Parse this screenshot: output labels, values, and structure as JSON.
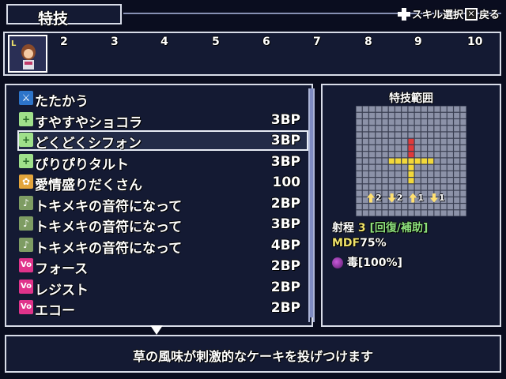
{
  "header": {
    "title": "特技",
    "hint_select": "スキル選択",
    "hint_back": "戻る"
  },
  "party": {
    "slots": [
      "2",
      "3",
      "4",
      "5",
      "6",
      "7",
      "8",
      "9",
      "10"
    ]
  },
  "skills": [
    {
      "name": "たたかう",
      "cost": "",
      "icon": "attack-icon"
    },
    {
      "name": "すやすやショコラ",
      "cost": "3BP",
      "icon": "heal-plus-icon"
    },
    {
      "name": "どくどくシフォン",
      "cost": "3BP",
      "icon": "heal-plus-icon"
    },
    {
      "name": "ぴりぴりタルト",
      "cost": "3BP",
      "icon": "heal-plus-icon"
    },
    {
      "name": "愛情盛りだくさん",
      "cost": "100",
      "icon": "heart-burst-icon"
    },
    {
      "name": "トキメキの音符になって",
      "cost": "2BP",
      "icon": "music-note-icon"
    },
    {
      "name": "トキメキの音符になって",
      "cost": "3BP",
      "icon": "music-note-icon"
    },
    {
      "name": "トキメキの音符になって",
      "cost": "4BP",
      "icon": "music-note-icon"
    },
    {
      "name": "フォース",
      "cost": "2BP",
      "icon": "vo-icon"
    },
    {
      "name": "レジスト",
      "cost": "2BP",
      "icon": "vo-icon"
    },
    {
      "name": "エコー",
      "cost": "2BP",
      "icon": "vo-icon"
    }
  ],
  "selected_index": 2,
  "range": {
    "title": "特技範囲",
    "targets": [
      {
        "dir": "up",
        "value": "2"
      },
      {
        "dir": "down",
        "value": "2"
      },
      {
        "dir": "up",
        "value": "1"
      },
      {
        "dir": "down",
        "value": "1"
      }
    ],
    "range_label": "射程",
    "range_value": "3",
    "range_type_open": "[回復/",
    "range_type_support": "補助",
    "range_type_close": "]",
    "mdf_label": "MDF",
    "mdf_value": "75%",
    "status_effect": "毒[100%]"
  },
  "description": "草の風味が刺激的なケーキを投げつけます",
  "colors": {
    "panel_bg": "#141a33",
    "border": "#d8dce8",
    "highlight_yellow": "#f0e36a",
    "highlight_green": "#8de07c",
    "range_red": "#e03a3a",
    "range_yellow": "#f2d83a"
  }
}
